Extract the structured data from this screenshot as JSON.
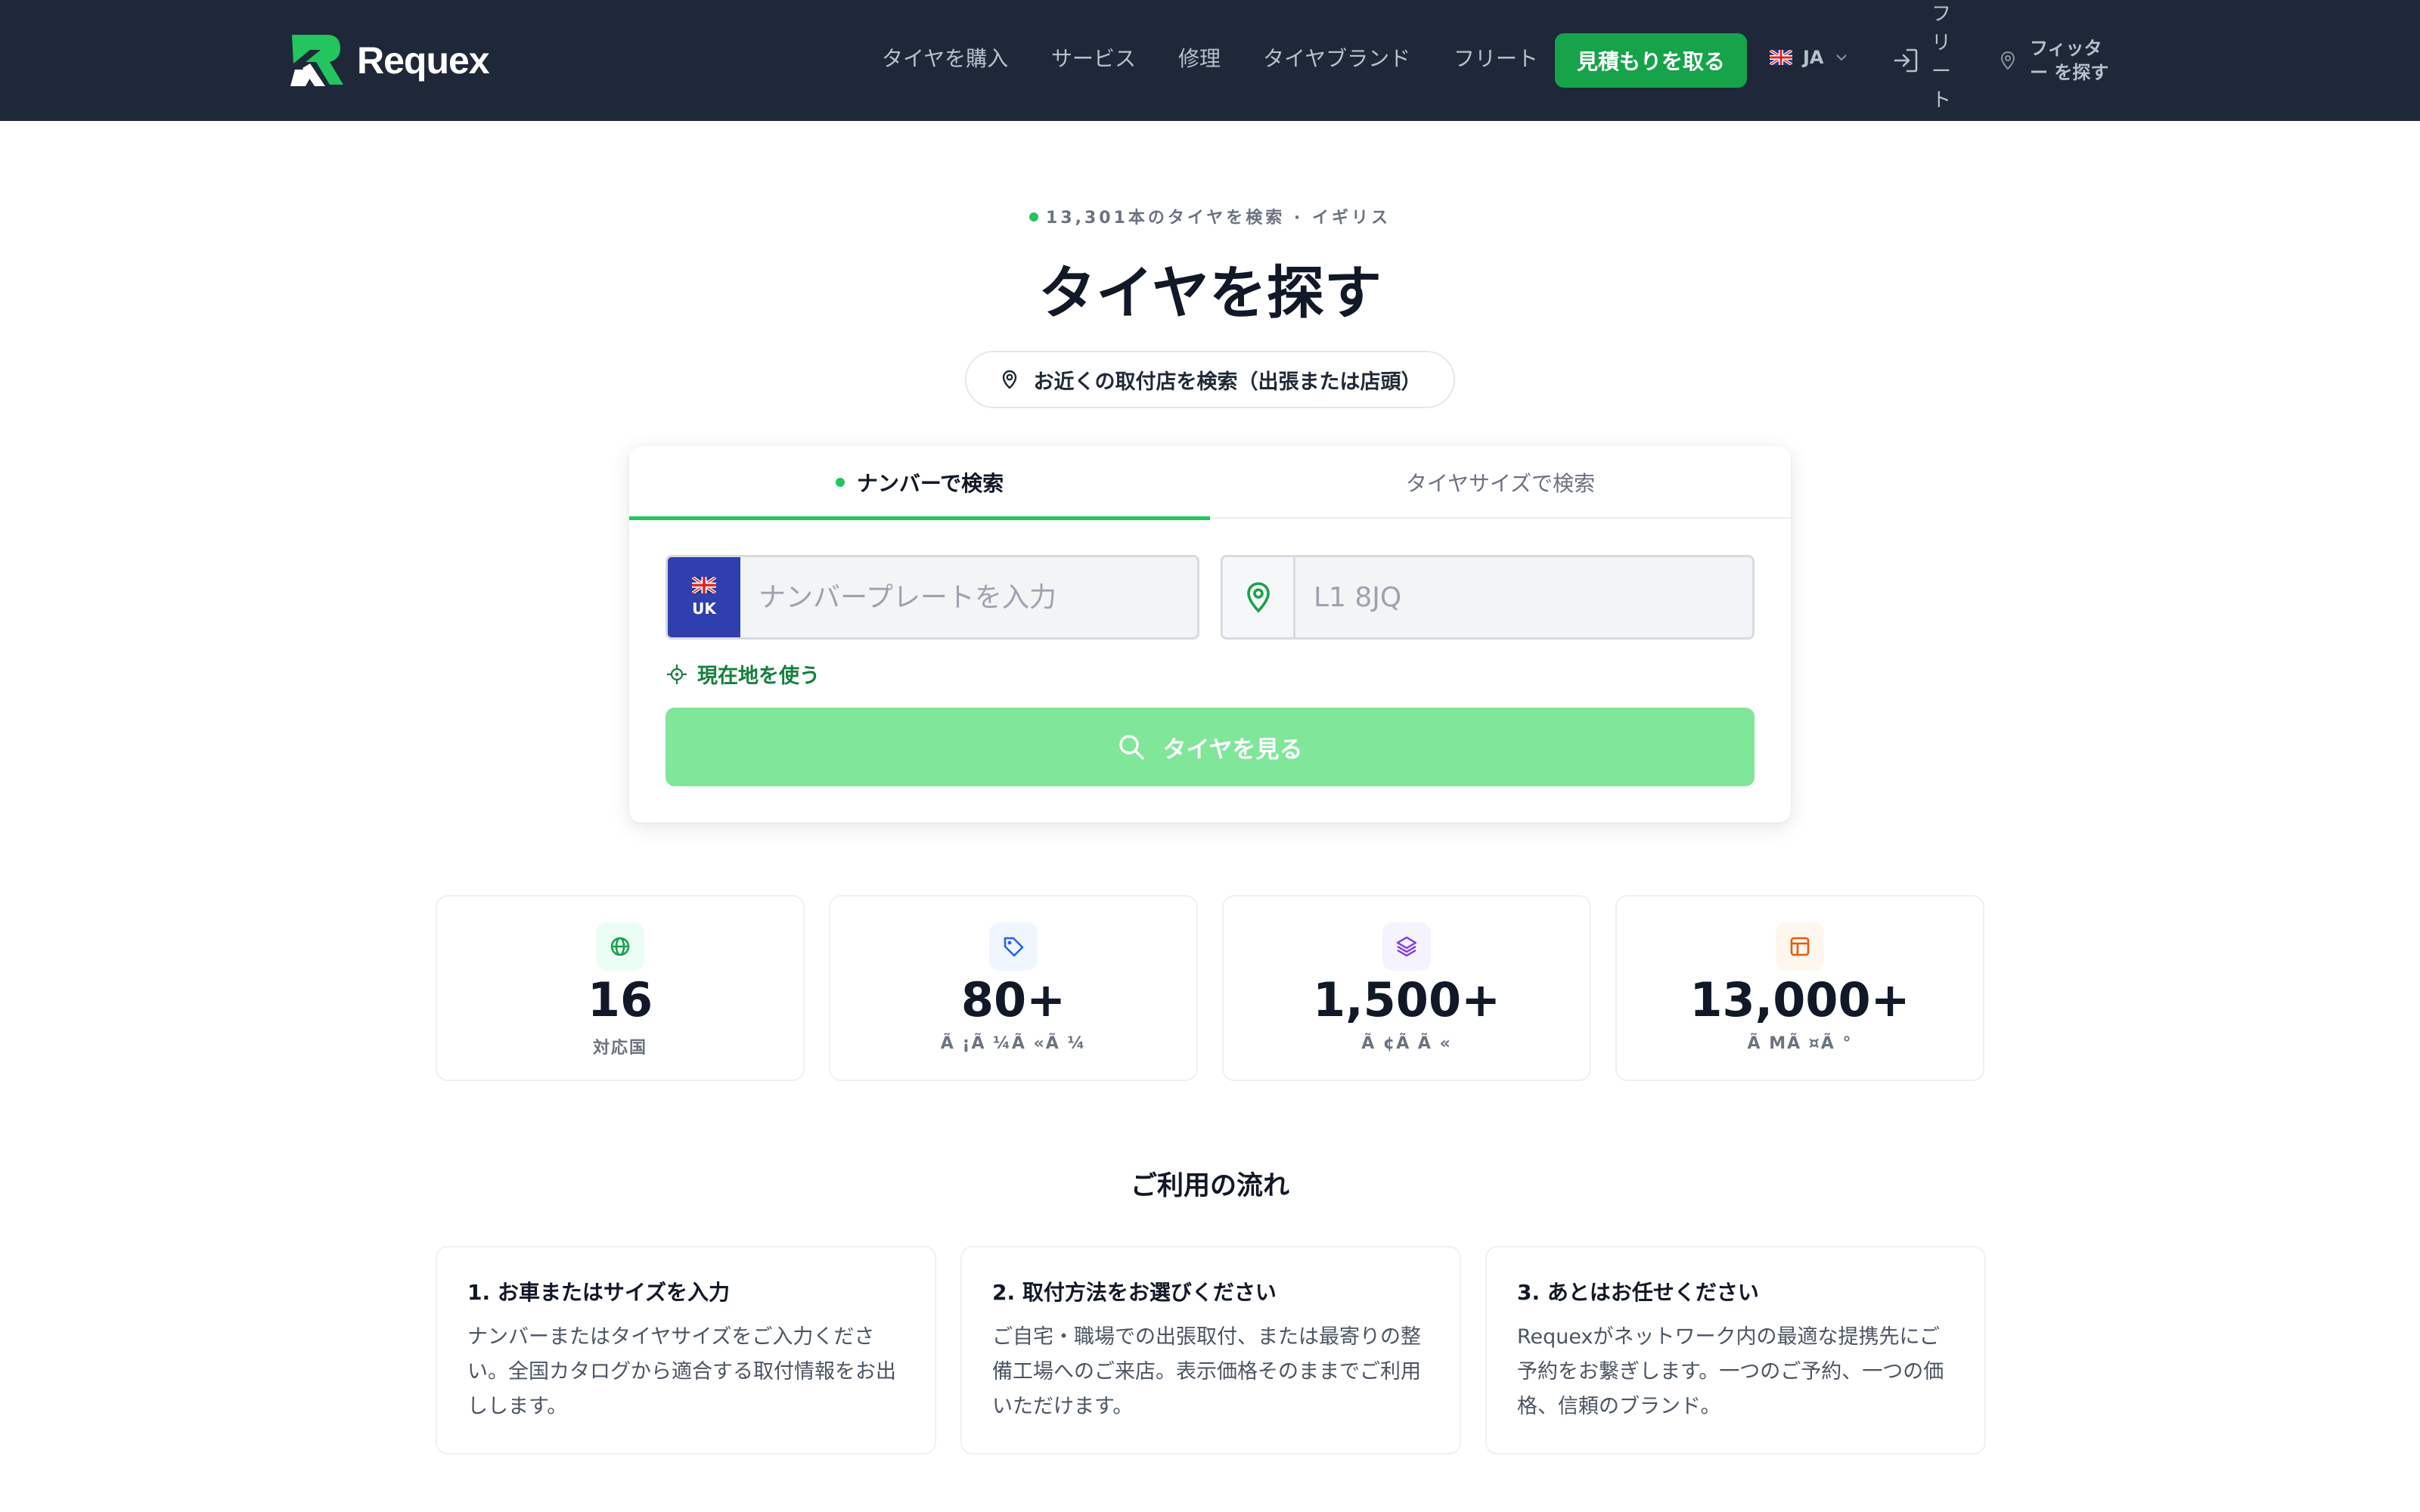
{
  "brand": {
    "name": "Requex"
  },
  "nav": {
    "links": [
      "タイヤを購入",
      "サービス",
      "修理",
      "タイヤブランド",
      "フリート"
    ],
    "quote_button": "見積もりを取る",
    "language": "JA",
    "fleet_vertical": "フリート",
    "find_shop": "フィッター を探す"
  },
  "hero": {
    "eyebrow": "13,301本のタイヤを検索 · イギリス",
    "title": "タイヤを探す",
    "fitter_pill": "お近くの取付店を検索（出張または店頭）"
  },
  "search": {
    "tabs": [
      "ナンバーで検索",
      "タイヤサイズで検索"
    ],
    "active_tab": 0,
    "plate": {
      "country": "UK",
      "placeholder": "ナンバープレートを入力",
      "value": ""
    },
    "postcode": {
      "placeholder": "L1 8JQ",
      "value": ""
    },
    "use_location": "現在地を使う",
    "submit": "タイヤを見る"
  },
  "stats": [
    {
      "value": "16",
      "label": "対応国",
      "icon": "globe-icon",
      "color": "#16a34a",
      "bg": "#ecfdf3"
    },
    {
      "value": "80+",
      "label": "Ã ¡Ã ¼Ã «Ã ¼",
      "icon": "tag-icon",
      "color": "#2563eb",
      "bg": "#eff6ff"
    },
    {
      "value": "1,500+",
      "label": "Ã ¢Ã Ã «",
      "icon": "layers-icon",
      "color": "#7c3aed",
      "bg": "#f5f3ff"
    },
    {
      "value": "13,000+",
      "label": "Ã MÃ ¤Ã °",
      "icon": "box-icon",
      "color": "#ea580c",
      "bg": "#fff7ed"
    }
  ],
  "how_it_works": {
    "title": "ご利用の流れ",
    "steps": [
      {
        "title": "1. お車またはサイズを入力",
        "body": "ナンバーまたはタイヤサイズをご入力ください。全国カタログから適合する取付情報をお出しします。"
      },
      {
        "title": "2. 取付方法をお選びください",
        "body": "ご自宅・職場での出張取付、または最寄りの整備工場へのご来店。表示価格そのままでご利用いただけます。"
      },
      {
        "title": "3. あとはお任せください",
        "body": "Requexがネットワーク内の最適な提携先にご予約をお繋ぎします。一つのご予約、一つの価格、信頼のブランド。"
      }
    ]
  },
  "colors": {
    "header_bg": "#1e2838",
    "accent": "#16a34a",
    "button_disabled": "#80e69a"
  }
}
